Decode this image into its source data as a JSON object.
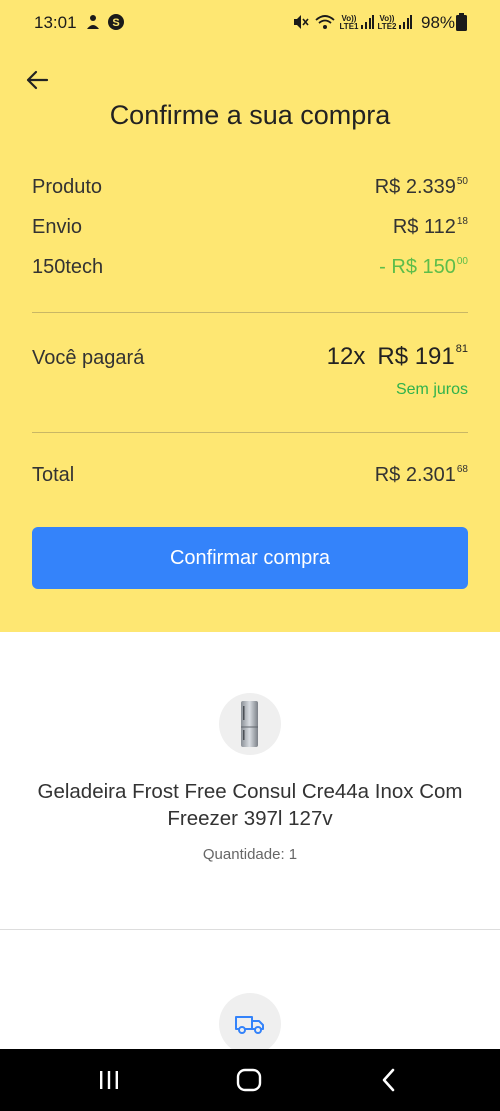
{
  "status_bar": {
    "time": "13:01",
    "net1": "Vo)) LTE1",
    "net2": "Vo)) LTE2",
    "battery": "98%",
    "icons": [
      "notification-icon",
      "s-app-icon",
      "mute-icon",
      "wifi-icon",
      "signal-icon",
      "battery-icon"
    ]
  },
  "header": {
    "title": "Confirme a sua compra"
  },
  "summary": {
    "rows": [
      {
        "label": "Produto",
        "value_main": "R$ 2.339",
        "value_cents": "50"
      },
      {
        "label": "Envio",
        "value_main": "R$ 112",
        "value_cents": "18"
      },
      {
        "label": "150tech",
        "value_main": "- R$ 150",
        "value_cents": "00"
      }
    ],
    "pay_label": "Você pagará",
    "pay_installments": "12x",
    "pay_main": "R$ 191",
    "pay_cents": "81",
    "pay_note": "Sem juros",
    "total_label": "Total",
    "total_main": "R$ 2.301",
    "total_cents": "68"
  },
  "confirm_button": "Confirmar compra",
  "product": {
    "title": "Geladeira Frost Free Consul Cre44a Inox Com Freezer 397l 127v",
    "quantity": "Quantidade: 1"
  },
  "colors": {
    "background_top": "#fee772",
    "button": "#3483fa",
    "discount": "#5dbd4a",
    "no_interest": "#2fb24c"
  },
  "navbar_icons": [
    "recent-apps-icon",
    "home-icon",
    "back-nav-icon"
  ]
}
